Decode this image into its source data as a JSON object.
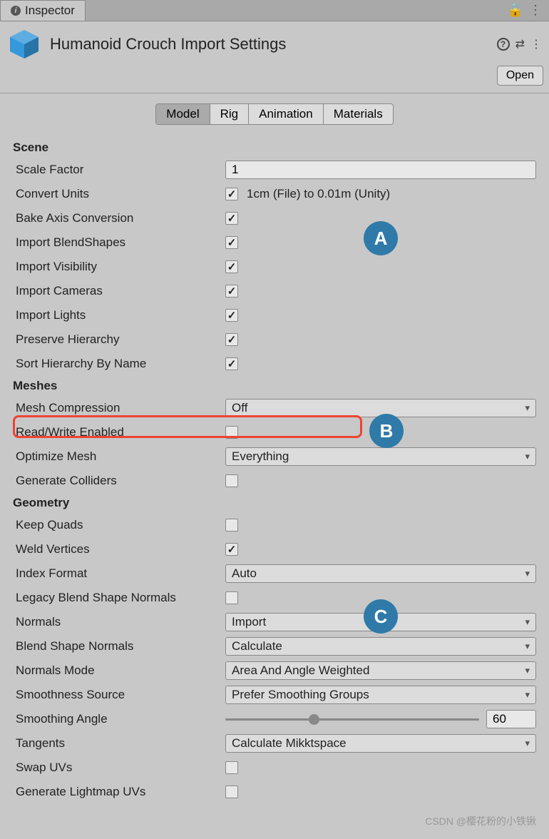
{
  "tab": {
    "label": "Inspector"
  },
  "header": {
    "title": "Humanoid Crouch Import Settings",
    "open_label": "Open"
  },
  "tabs": [
    "Model",
    "Rig",
    "Animation",
    "Materials"
  ],
  "sections": {
    "scene": {
      "header": "Scene",
      "scale_factor_label": "Scale Factor",
      "scale_factor_value": "1",
      "convert_units_label": "Convert Units",
      "convert_units_text": "1cm (File) to 0.01m (Unity)",
      "bake_axis_label": "Bake Axis Conversion",
      "import_blendshapes_label": "Import BlendShapes",
      "import_visibility_label": "Import Visibility",
      "import_cameras_label": "Import Cameras",
      "import_lights_label": "Import Lights",
      "preserve_hierarchy_label": "Preserve Hierarchy",
      "sort_hierarchy_label": "Sort Hierarchy By Name"
    },
    "meshes": {
      "header": "Meshes",
      "mesh_compression_label": "Mesh Compression",
      "mesh_compression_value": "Off",
      "read_write_label": "Read/Write Enabled",
      "optimize_mesh_label": "Optimize Mesh",
      "optimize_mesh_value": "Everything",
      "generate_colliders_label": "Generate Colliders"
    },
    "geometry": {
      "header": "Geometry",
      "keep_quads_label": "Keep Quads",
      "weld_vertices_label": "Weld Vertices",
      "index_format_label": "Index Format",
      "index_format_value": "Auto",
      "legacy_blend_label": "Legacy Blend Shape Normals",
      "normals_label": "Normals",
      "normals_value": "Import",
      "blend_shape_normals_label": "Blend Shape Normals",
      "blend_shape_normals_value": "Calculate",
      "normals_mode_label": "Normals Mode",
      "normals_mode_value": "Area And Angle Weighted",
      "smoothness_source_label": "Smoothness Source",
      "smoothness_source_value": "Prefer Smoothing Groups",
      "smoothing_angle_label": "Smoothing Angle",
      "smoothing_angle_value": "60",
      "tangents_label": "Tangents",
      "tangents_value": "Calculate Mikktspace",
      "swap_uvs_label": "Swap UVs",
      "generate_lightmap_label": "Generate Lightmap UVs"
    }
  },
  "annotations": {
    "a": "A",
    "b": "B",
    "c": "C"
  },
  "watermark": "CSDN @樱花粉的小铁锹"
}
